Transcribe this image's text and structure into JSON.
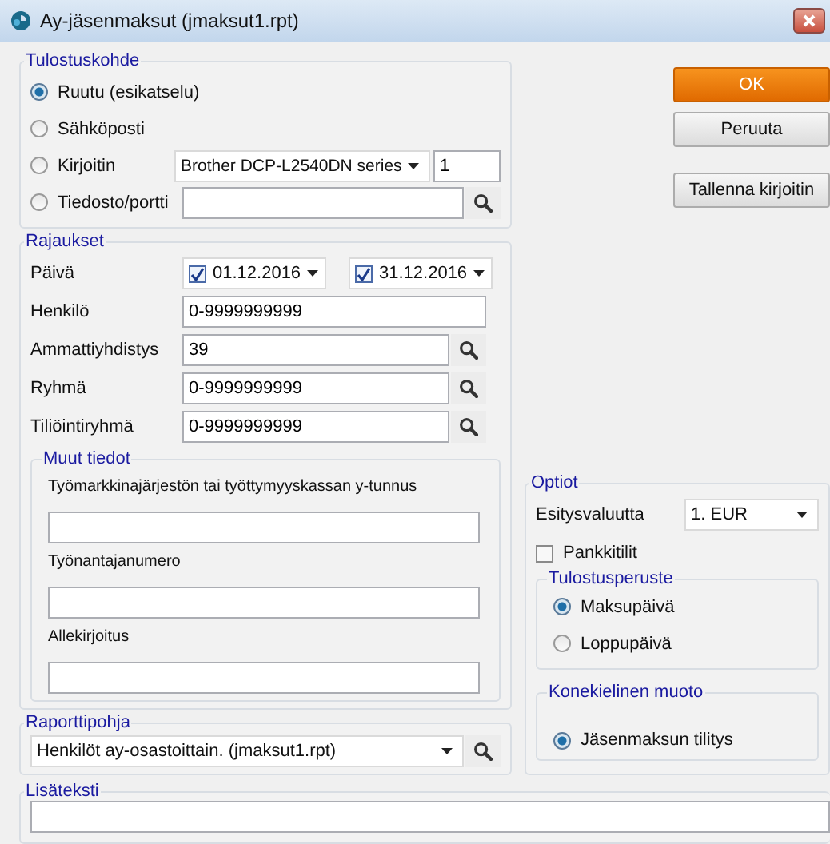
{
  "window": {
    "title": "Ay-jäsenmaksut (jmaksut1.rpt)"
  },
  "output_target": {
    "title": "Tulostuskohde",
    "options": [
      {
        "label": "Ruutu (esikatselu)",
        "selected": true,
        "kind": "plain"
      },
      {
        "label": "Sähköposti",
        "selected": false,
        "kind": "plain"
      },
      {
        "label": "Kirjoitin",
        "selected": false,
        "kind": "printer",
        "printer": "Brother DCP-L2540DN series",
        "copies": "1"
      },
      {
        "label": "Tiedosto/portti",
        "selected": false,
        "kind": "file"
      }
    ]
  },
  "filters": {
    "title": "Rajaukset",
    "date": {
      "label": "Päivä",
      "range": [
        {
          "value": "01.12.2016",
          "checked": true
        },
        {
          "value": "31.12.2016",
          "checked": true
        }
      ]
    },
    "fields": [
      {
        "label": "Henkilö",
        "value": "0-9999999999",
        "lookup": false
      },
      {
        "label": "Ammattiyhdistys",
        "value": "39",
        "lookup": true
      },
      {
        "label": "Ryhmä",
        "value": "0-9999999999",
        "lookup": true
      },
      {
        "label": "Tiliöintiryhmä",
        "value": "0-9999999999",
        "lookup": true
      }
    ],
    "other_info": {
      "title": "Muut tiedot",
      "fields": [
        {
          "label": "Työmarkkinajärjestön tai työttymyyskassan y-tunnus"
        },
        {
          "label": "Työnantajanumero"
        },
        {
          "label": "Allekirjoitus"
        }
      ]
    }
  },
  "report_template": {
    "title": "Raporttipohja",
    "value": "Henkilöt ay-osastoittain. (jmaksut1.rpt)"
  },
  "buttons": [
    {
      "label": "OK",
      "kind": "primary"
    },
    {
      "label": "Peruuta",
      "kind": "normal"
    },
    {
      "label": "Tallenna kirjoitin",
      "kind": "normal"
    }
  ],
  "options": {
    "title": "Optiot",
    "currency": {
      "label": "Esitysvaluutta",
      "value": "1. EUR"
    },
    "bank_accounts": {
      "label": "Pankkitilit",
      "checked": false
    },
    "print_basis": {
      "title": "Tulostusperuste",
      "options": [
        {
          "label": "Maksupäivä",
          "selected": true
        },
        {
          "label": "Loppupäivä",
          "selected": false
        }
      ]
    },
    "machine_format": {
      "title": "Konekielinen muoto",
      "options": [
        {
          "label": "Jäsenmaksun tilitys",
          "selected": true
        }
      ]
    }
  },
  "extra_text": {
    "title": "Lisäteksti"
  }
}
